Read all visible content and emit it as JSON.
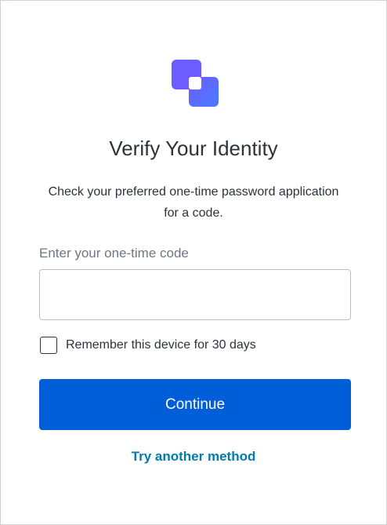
{
  "page": {
    "title": "Verify Your Identity",
    "description": "Check your preferred one-time password application for a code.",
    "logo_icon": "brand-logo-icon",
    "colors": {
      "primary_button": "#005ed8",
      "link": "#007bad",
      "logo_gradient_start": "#6d5cff",
      "logo_gradient_end": "#4a7bff"
    }
  },
  "form": {
    "code_label": "Enter your one-time code",
    "code_value": "",
    "remember_label": "Remember this device for 30 days",
    "remember_checked": false,
    "continue_label": "Continue",
    "alternate_link": "Try another method"
  }
}
